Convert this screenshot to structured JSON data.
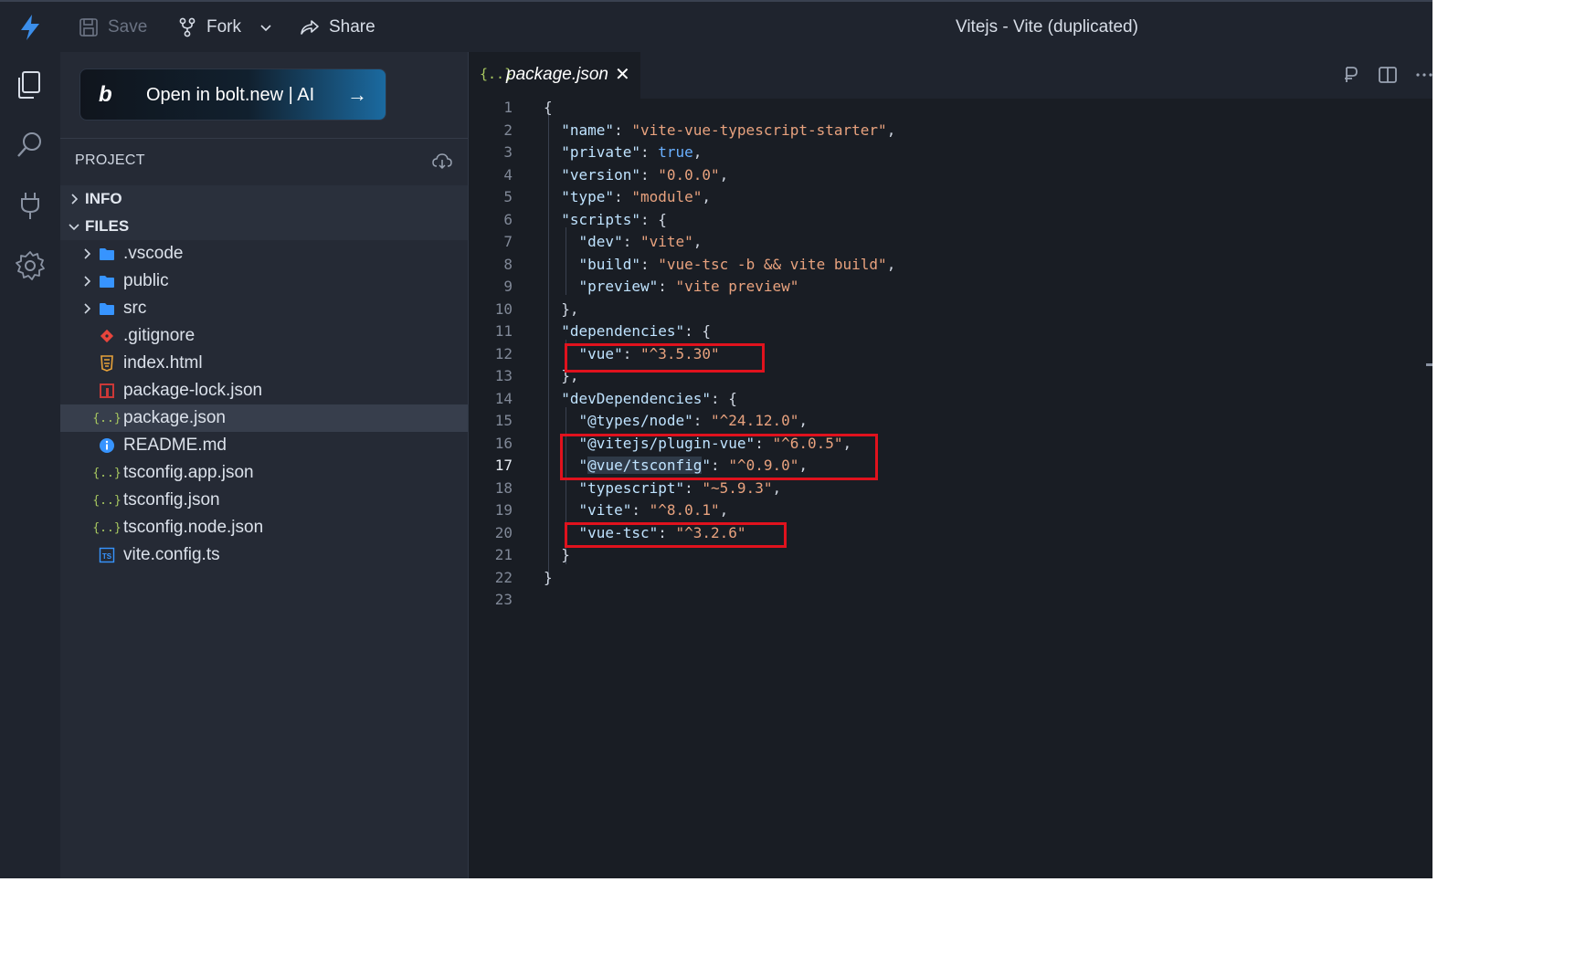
{
  "topbar": {
    "save_label": "Save",
    "fork_label": "Fork",
    "share_label": "Share",
    "window_title": "Vitejs - Vite (duplicated)"
  },
  "sidebar": {
    "bolt_button_label": "Open in bolt.new | AI",
    "project_header": "PROJECT",
    "sections": {
      "info": "INFO",
      "files": "FILES"
    },
    "files": [
      {
        "name": ".vscode",
        "icon": "folder-icon",
        "color": "#3794ff"
      },
      {
        "name": "public",
        "icon": "folder-icon",
        "color": "#3794ff"
      },
      {
        "name": "src",
        "icon": "folder-icon",
        "color": "#3794ff"
      },
      {
        "name": ".gitignore",
        "icon": "git-icon",
        "color": "#e8453c"
      },
      {
        "name": "index.html",
        "icon": "html5-icon",
        "color": "#e7a23a"
      },
      {
        "name": "package-lock.json",
        "icon": "npm-icon",
        "color": "#cb3837"
      },
      {
        "name": "package.json",
        "icon": "json-icon",
        "color": "#a8c860",
        "selected": true
      },
      {
        "name": "README.md",
        "icon": "info-icon",
        "color": "#3794ff"
      },
      {
        "name": "tsconfig.app.json",
        "icon": "json-icon",
        "color": "#a8c860"
      },
      {
        "name": "tsconfig.json",
        "icon": "json-icon",
        "color": "#a8c860"
      },
      {
        "name": "tsconfig.node.json",
        "icon": "json-icon",
        "color": "#a8c860"
      },
      {
        "name": "vite.config.ts",
        "icon": "typescript-icon",
        "color": "#3794ff"
      }
    ]
  },
  "editor": {
    "tab_label": "package.json",
    "tab_icon_text": "{..}",
    "active_line": 17,
    "line_numbers": [
      "1",
      "2",
      "3",
      "4",
      "5",
      "6",
      "7",
      "8",
      "9",
      "10",
      "11",
      "12",
      "13",
      "14",
      "15",
      "16",
      "17",
      "18",
      "19",
      "20",
      "21",
      "22",
      "23"
    ]
  }
}
